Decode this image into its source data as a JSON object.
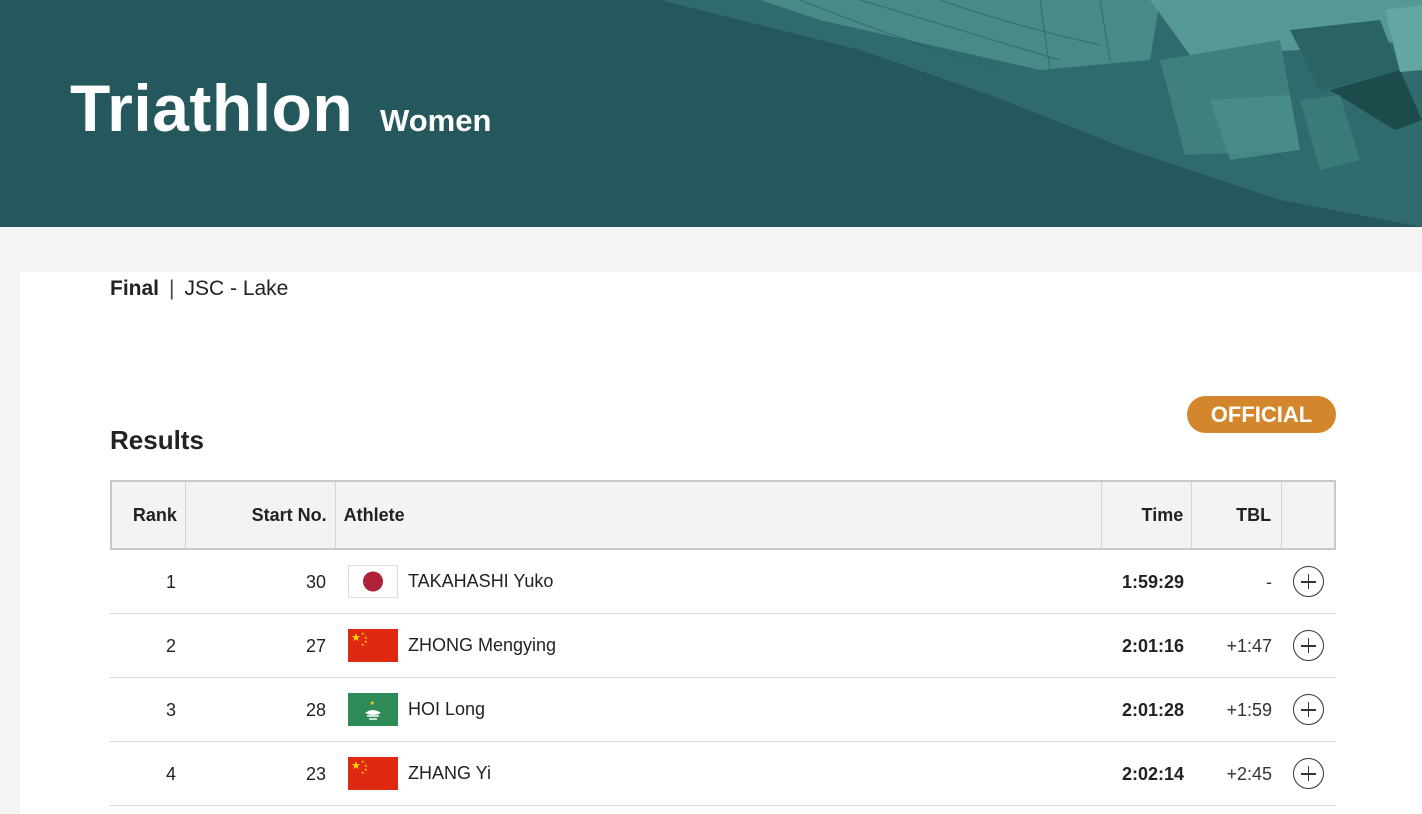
{
  "header": {
    "sport": "Triathlon",
    "event": "Women"
  },
  "breadcrumb": {
    "stage": "Final",
    "separator": "|",
    "venue": "JSC - Lake"
  },
  "results": {
    "title": "Results",
    "status_badge": "OFFICIAL",
    "columns": {
      "rank": "Rank",
      "start_no": "Start No.",
      "athlete": "Athlete",
      "time": "Time",
      "tbl": "TBL"
    },
    "rows": [
      {
        "rank": "1",
        "start_no": "30",
        "flag": "japan-flag-icon",
        "athlete": "TAKAHASHI Yuko",
        "time": "1:59:29",
        "tbl": "-"
      },
      {
        "rank": "2",
        "start_no": "27",
        "flag": "china-flag-icon",
        "athlete": "ZHONG Mengying",
        "time": "2:01:16",
        "tbl": "+1:47"
      },
      {
        "rank": "3",
        "start_no": "28",
        "flag": "macao-flag-icon",
        "athlete": "HOI Long",
        "time": "2:01:28",
        "tbl": "+1:59"
      },
      {
        "rank": "4",
        "start_no": "23",
        "flag": "china-flag-icon",
        "athlete": "ZHANG Yi",
        "time": "2:02:14",
        "tbl": "+2:45"
      }
    ]
  },
  "colors": {
    "banner": "#25585c",
    "badge": "#d3862c"
  }
}
